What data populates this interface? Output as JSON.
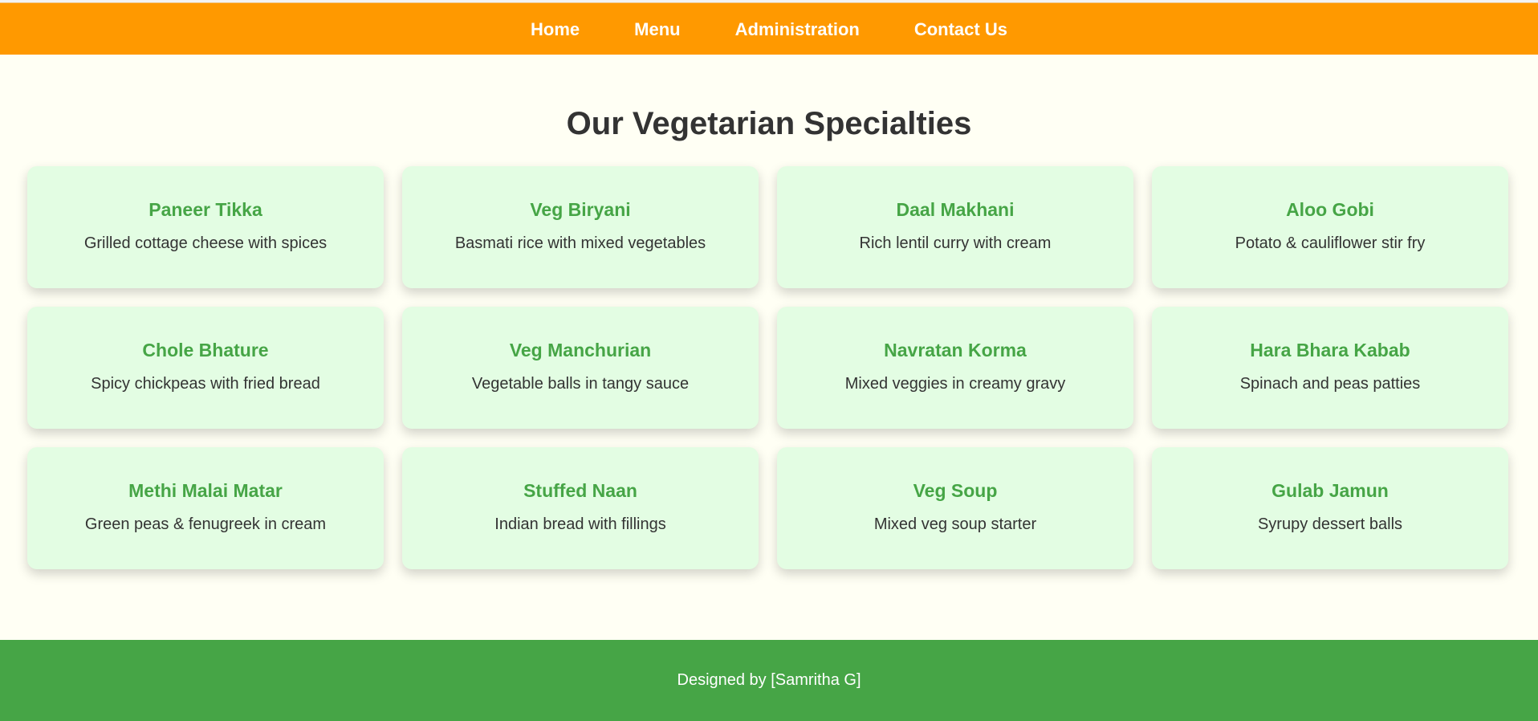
{
  "nav": {
    "items": [
      {
        "label": "Home"
      },
      {
        "label": "Menu"
      },
      {
        "label": "Administration"
      },
      {
        "label": "Contact Us"
      }
    ]
  },
  "main": {
    "title": "Our Vegetarian Specialties",
    "dishes": [
      {
        "name": "Paneer Tikka",
        "description": "Grilled cottage cheese with spices"
      },
      {
        "name": "Veg Biryani",
        "description": "Basmati rice with mixed vegetables"
      },
      {
        "name": "Daal Makhani",
        "description": "Rich lentil curry with cream"
      },
      {
        "name": "Aloo Gobi",
        "description": "Potato & cauliflower stir fry"
      },
      {
        "name": "Chole Bhature",
        "description": "Spicy chickpeas with fried bread"
      },
      {
        "name": "Veg Manchurian",
        "description": "Vegetable balls in tangy sauce"
      },
      {
        "name": "Navratan Korma",
        "description": "Mixed veggies in creamy gravy"
      },
      {
        "name": "Hara Bhara Kabab",
        "description": "Spinach and peas patties"
      },
      {
        "name": "Methi Malai Matar",
        "description": "Green peas & fenugreek in cream"
      },
      {
        "name": "Stuffed Naan",
        "description": "Indian bread with fillings"
      },
      {
        "name": "Veg Soup",
        "description": "Mixed veg soup starter"
      },
      {
        "name": "Gulab Jamun",
        "description": "Syrupy dessert balls"
      }
    ]
  },
  "footer": {
    "text": "Designed by [Samritha G]"
  },
  "colors": {
    "nav_background": "#ff9900",
    "page_background": "#fffff4",
    "card_background": "#e3fde3",
    "accent_green": "#46a546",
    "text_dark": "#333333"
  }
}
